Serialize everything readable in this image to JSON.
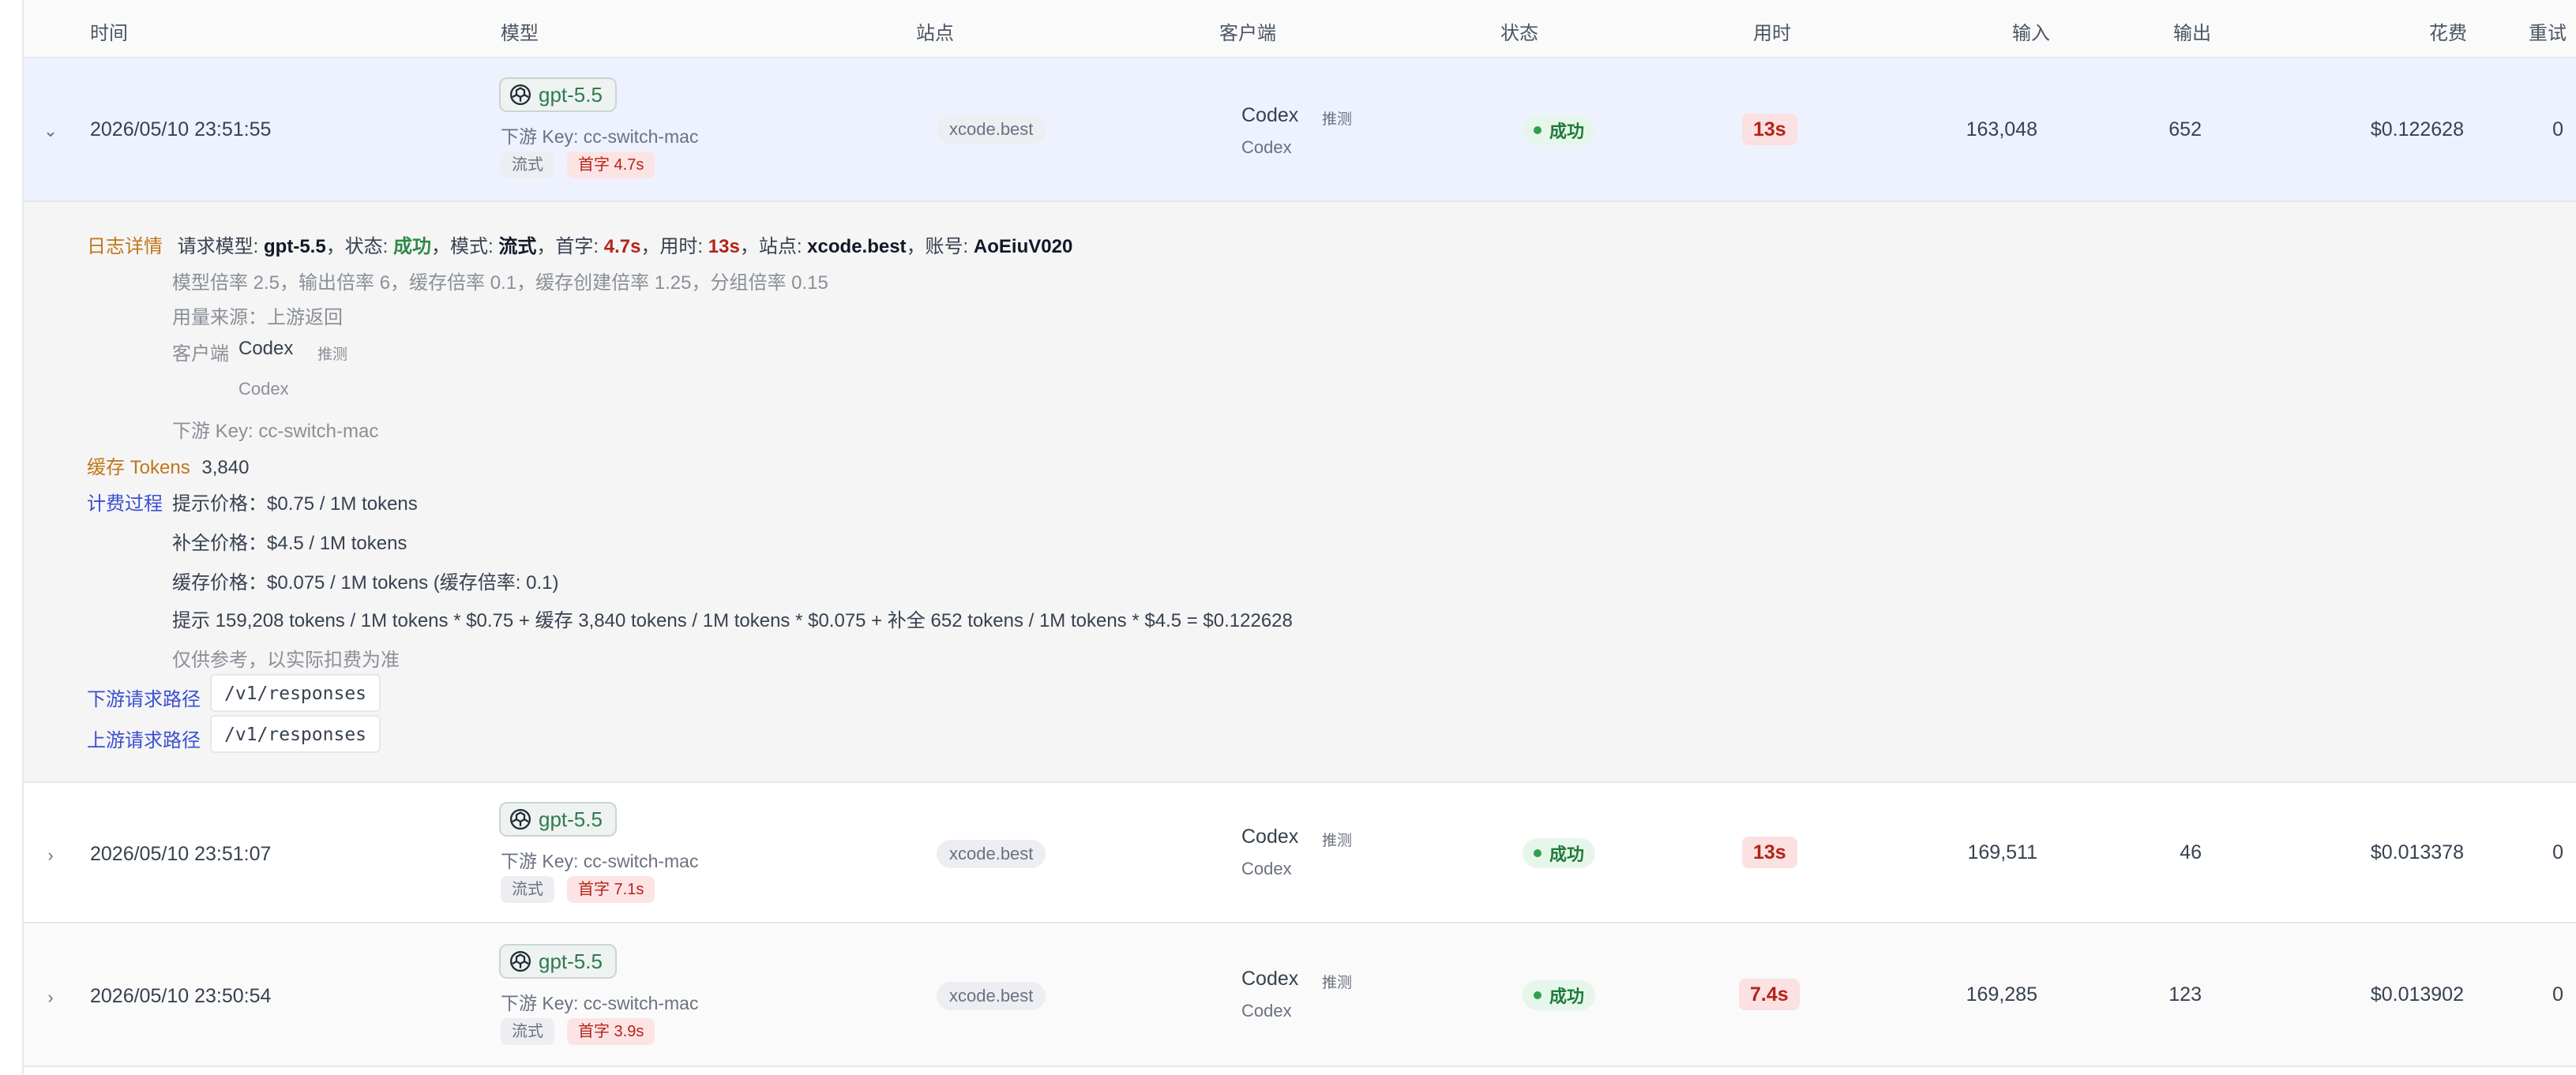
{
  "colors": {
    "accent_blue": "#3b4fd1",
    "accent_orange": "#c0761a",
    "success_green": "#2f8a45",
    "error_red": "#b42318",
    "selected_row": "#eef2fe"
  },
  "header": {
    "time": "时间",
    "model": "模型",
    "station": "站点",
    "client": "客户端",
    "status": "状态",
    "duration": "用时",
    "input": "输入",
    "output": "输出",
    "cost": "花费",
    "retry": "重试"
  },
  "rows": [
    {
      "time": "2026/05/10 23:51:55",
      "model": "gpt-5.5",
      "downstream_key": "下游 Key: cc-switch-mac",
      "mode": "流式",
      "first_token": "首字 4.7s",
      "station": "xcode.best",
      "client": "Codex",
      "client_guess": "推测",
      "client_sub": "Codex",
      "status": "成功",
      "duration": "13s",
      "input": "163,048",
      "output": "652",
      "cost": "$0.122628",
      "retry": "0",
      "expanded": true
    },
    {
      "time": "2026/05/10 23:51:07",
      "model": "gpt-5.5",
      "downstream_key": "下游 Key: cc-switch-mac",
      "mode": "流式",
      "first_token": "首字 7.1s",
      "station": "xcode.best",
      "client": "Codex",
      "client_guess": "推测",
      "client_sub": "Codex",
      "status": "成功",
      "duration": "13s",
      "input": "169,511",
      "output": "46",
      "cost": "$0.013378",
      "retry": "0",
      "expanded": false
    },
    {
      "time": "2026/05/10 23:50:54",
      "model": "gpt-5.5",
      "downstream_key": "下游 Key: cc-switch-mac",
      "mode": "流式",
      "first_token": "首字 3.9s",
      "station": "xcode.best",
      "client": "Codex",
      "client_guess": "推测",
      "client_sub": "Codex",
      "status": "成功",
      "duration": "7.4s",
      "input": "169,285",
      "output": "123",
      "cost": "$0.013902",
      "retry": "0",
      "expanded": false
    }
  ],
  "detail": {
    "log_label": "日志详情",
    "req_model_label": "请求模型: ",
    "req_model": "gpt-5.5",
    "status_label": "，状态: ",
    "status": "成功",
    "mode_label": "，模式: ",
    "mode": "流式",
    "first_label": "，首字: ",
    "first": "4.7s",
    "dur_label": "，用时: ",
    "dur": "13s",
    "station_label": "，站点: ",
    "station": "xcode.best",
    "account_label": "，账号: ",
    "account": "AoEiuV020",
    "rates": "模型倍率 2.5，输出倍率 6，缓存倍率 0.1，缓存创建倍率 1.25，分组倍率 0.15",
    "usage_source": "用量来源：上游返回",
    "client_label": "客户端",
    "client": "Codex",
    "client_guess": "推测",
    "client_sub": "Codex",
    "downstream_key": "下游 Key: cc-switch-mac",
    "cache_label": "缓存 Tokens",
    "cache_value": "3,840",
    "billing_label": "计费过程",
    "prompt_price": "提示价格：$0.75 / 1M tokens",
    "completion_price": "补全价格：$4.5 / 1M tokens",
    "cache_price": "缓存价格：$0.075 / 1M tokens (缓存倍率: 0.1)",
    "formula": "提示 159,208 tokens / 1M tokens * $0.75 + 缓存 3,840 tokens / 1M tokens * $0.075 + 补全 652 tokens / 1M tokens * $4.5 = $0.122628",
    "note": "仅供参考，以实际扣费为准",
    "down_path_label": "下游请求路径",
    "down_path": "/v1/responses",
    "up_path_label": "上游请求路径",
    "up_path": "/v1/responses"
  }
}
